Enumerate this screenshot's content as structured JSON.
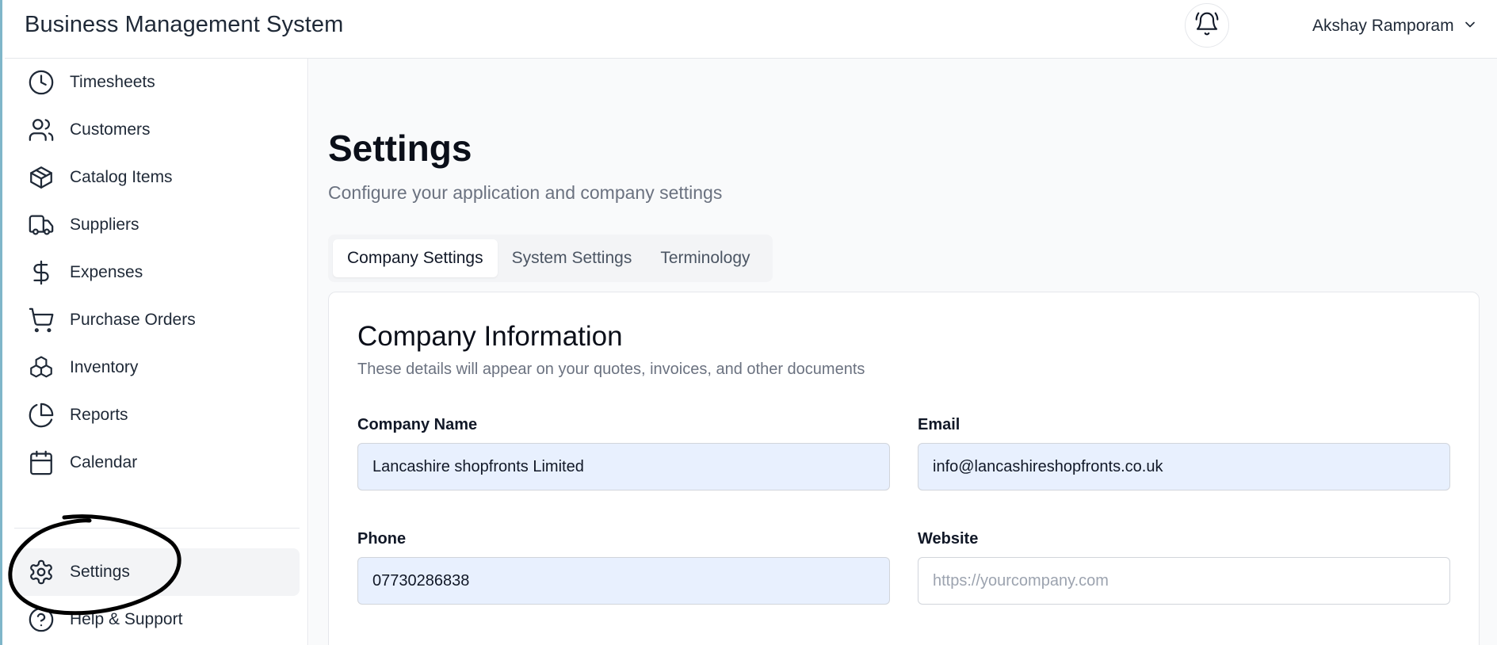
{
  "app": {
    "title": "Business Management System"
  },
  "header": {
    "bell_icon": "bell-ring-icon",
    "user_name": "Akshay Ramporam",
    "user_menu_icon": "chevron-down-icon"
  },
  "sidebar": {
    "items": [
      {
        "label": "Timesheets",
        "icon": "clock-icon"
      },
      {
        "label": "Customers",
        "icon": "users-icon"
      },
      {
        "label": "Catalog Items",
        "icon": "package-icon"
      },
      {
        "label": "Suppliers",
        "icon": "truck-icon"
      },
      {
        "label": "Expenses",
        "icon": "dollar-icon"
      },
      {
        "label": "Purchase Orders",
        "icon": "cart-icon"
      },
      {
        "label": "Inventory",
        "icon": "boxes-icon"
      },
      {
        "label": "Reports",
        "icon": "pie-chart-icon"
      },
      {
        "label": "Calendar",
        "icon": "calendar-icon"
      }
    ],
    "bottom_items": [
      {
        "label": "Settings",
        "icon": "gear-icon",
        "active": true
      },
      {
        "label": "Help & Support",
        "icon": "help-circle-icon"
      }
    ]
  },
  "main": {
    "title": "Settings",
    "subtitle": "Configure your application and company settings",
    "tabs": [
      {
        "label": "Company Settings",
        "active": true
      },
      {
        "label": "System Settings"
      },
      {
        "label": "Terminology"
      }
    ],
    "card": {
      "title": "Company Information",
      "description": "These details will appear on your quotes, invoices, and other documents",
      "fields": {
        "company_name": {
          "label": "Company Name",
          "value": "Lancashire shopfronts Limited"
        },
        "email": {
          "label": "Email",
          "value": "info@lancashireshopfronts.co.uk"
        },
        "phone": {
          "label": "Phone",
          "value": "07730286838"
        },
        "website": {
          "label": "Website",
          "value": "",
          "placeholder": "https://yourcompany.com"
        }
      }
    }
  },
  "colors": {
    "accent_border": "#7fb6c9",
    "autofill_bg": "#e8f0fe",
    "main_bg": "#f9fafb"
  }
}
